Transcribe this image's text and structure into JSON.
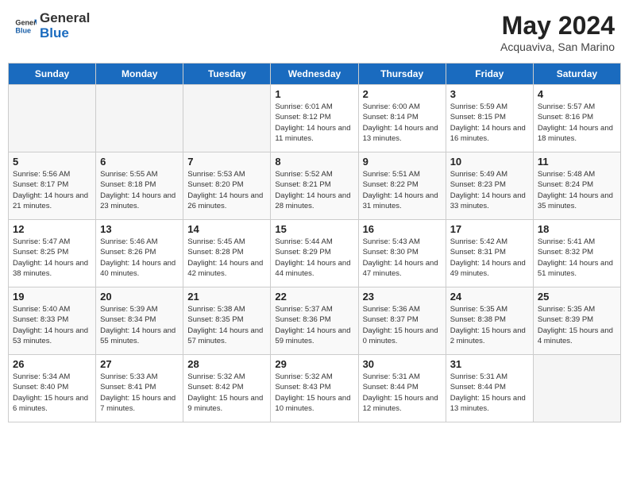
{
  "header": {
    "logo_general": "General",
    "logo_blue": "Blue",
    "month": "May 2024",
    "location": "Acquaviva, San Marino"
  },
  "days_of_week": [
    "Sunday",
    "Monday",
    "Tuesday",
    "Wednesday",
    "Thursday",
    "Friday",
    "Saturday"
  ],
  "weeks": [
    [
      {
        "day": "",
        "empty": true
      },
      {
        "day": "",
        "empty": true
      },
      {
        "day": "",
        "empty": true
      },
      {
        "day": "1",
        "sunrise": "6:01 AM",
        "sunset": "8:12 PM",
        "daylight": "14 hours and 11 minutes."
      },
      {
        "day": "2",
        "sunrise": "6:00 AM",
        "sunset": "8:14 PM",
        "daylight": "14 hours and 13 minutes."
      },
      {
        "day": "3",
        "sunrise": "5:59 AM",
        "sunset": "8:15 PM",
        "daylight": "14 hours and 16 minutes."
      },
      {
        "day": "4",
        "sunrise": "5:57 AM",
        "sunset": "8:16 PM",
        "daylight": "14 hours and 18 minutes."
      }
    ],
    [
      {
        "day": "5",
        "sunrise": "5:56 AM",
        "sunset": "8:17 PM",
        "daylight": "14 hours and 21 minutes."
      },
      {
        "day": "6",
        "sunrise": "5:55 AM",
        "sunset": "8:18 PM",
        "daylight": "14 hours and 23 minutes."
      },
      {
        "day": "7",
        "sunrise": "5:53 AM",
        "sunset": "8:20 PM",
        "daylight": "14 hours and 26 minutes."
      },
      {
        "day": "8",
        "sunrise": "5:52 AM",
        "sunset": "8:21 PM",
        "daylight": "14 hours and 28 minutes."
      },
      {
        "day": "9",
        "sunrise": "5:51 AM",
        "sunset": "8:22 PM",
        "daylight": "14 hours and 31 minutes."
      },
      {
        "day": "10",
        "sunrise": "5:49 AM",
        "sunset": "8:23 PM",
        "daylight": "14 hours and 33 minutes."
      },
      {
        "day": "11",
        "sunrise": "5:48 AM",
        "sunset": "8:24 PM",
        "daylight": "14 hours and 35 minutes."
      }
    ],
    [
      {
        "day": "12",
        "sunrise": "5:47 AM",
        "sunset": "8:25 PM",
        "daylight": "14 hours and 38 minutes."
      },
      {
        "day": "13",
        "sunrise": "5:46 AM",
        "sunset": "8:26 PM",
        "daylight": "14 hours and 40 minutes."
      },
      {
        "day": "14",
        "sunrise": "5:45 AM",
        "sunset": "8:28 PM",
        "daylight": "14 hours and 42 minutes."
      },
      {
        "day": "15",
        "sunrise": "5:44 AM",
        "sunset": "8:29 PM",
        "daylight": "14 hours and 44 minutes."
      },
      {
        "day": "16",
        "sunrise": "5:43 AM",
        "sunset": "8:30 PM",
        "daylight": "14 hours and 47 minutes."
      },
      {
        "day": "17",
        "sunrise": "5:42 AM",
        "sunset": "8:31 PM",
        "daylight": "14 hours and 49 minutes."
      },
      {
        "day": "18",
        "sunrise": "5:41 AM",
        "sunset": "8:32 PM",
        "daylight": "14 hours and 51 minutes."
      }
    ],
    [
      {
        "day": "19",
        "sunrise": "5:40 AM",
        "sunset": "8:33 PM",
        "daylight": "14 hours and 53 minutes."
      },
      {
        "day": "20",
        "sunrise": "5:39 AM",
        "sunset": "8:34 PM",
        "daylight": "14 hours and 55 minutes."
      },
      {
        "day": "21",
        "sunrise": "5:38 AM",
        "sunset": "8:35 PM",
        "daylight": "14 hours and 57 minutes."
      },
      {
        "day": "22",
        "sunrise": "5:37 AM",
        "sunset": "8:36 PM",
        "daylight": "14 hours and 59 minutes."
      },
      {
        "day": "23",
        "sunrise": "5:36 AM",
        "sunset": "8:37 PM",
        "daylight": "15 hours and 0 minutes."
      },
      {
        "day": "24",
        "sunrise": "5:35 AM",
        "sunset": "8:38 PM",
        "daylight": "15 hours and 2 minutes."
      },
      {
        "day": "25",
        "sunrise": "5:35 AM",
        "sunset": "8:39 PM",
        "daylight": "15 hours and 4 minutes."
      }
    ],
    [
      {
        "day": "26",
        "sunrise": "5:34 AM",
        "sunset": "8:40 PM",
        "daylight": "15 hours and 6 minutes."
      },
      {
        "day": "27",
        "sunrise": "5:33 AM",
        "sunset": "8:41 PM",
        "daylight": "15 hours and 7 minutes."
      },
      {
        "day": "28",
        "sunrise": "5:32 AM",
        "sunset": "8:42 PM",
        "daylight": "15 hours and 9 minutes."
      },
      {
        "day": "29",
        "sunrise": "5:32 AM",
        "sunset": "8:43 PM",
        "daylight": "15 hours and 10 minutes."
      },
      {
        "day": "30",
        "sunrise": "5:31 AM",
        "sunset": "8:44 PM",
        "daylight": "15 hours and 12 minutes."
      },
      {
        "day": "31",
        "sunrise": "5:31 AM",
        "sunset": "8:44 PM",
        "daylight": "15 hours and 13 minutes."
      },
      {
        "day": "",
        "empty": true
      }
    ]
  ]
}
